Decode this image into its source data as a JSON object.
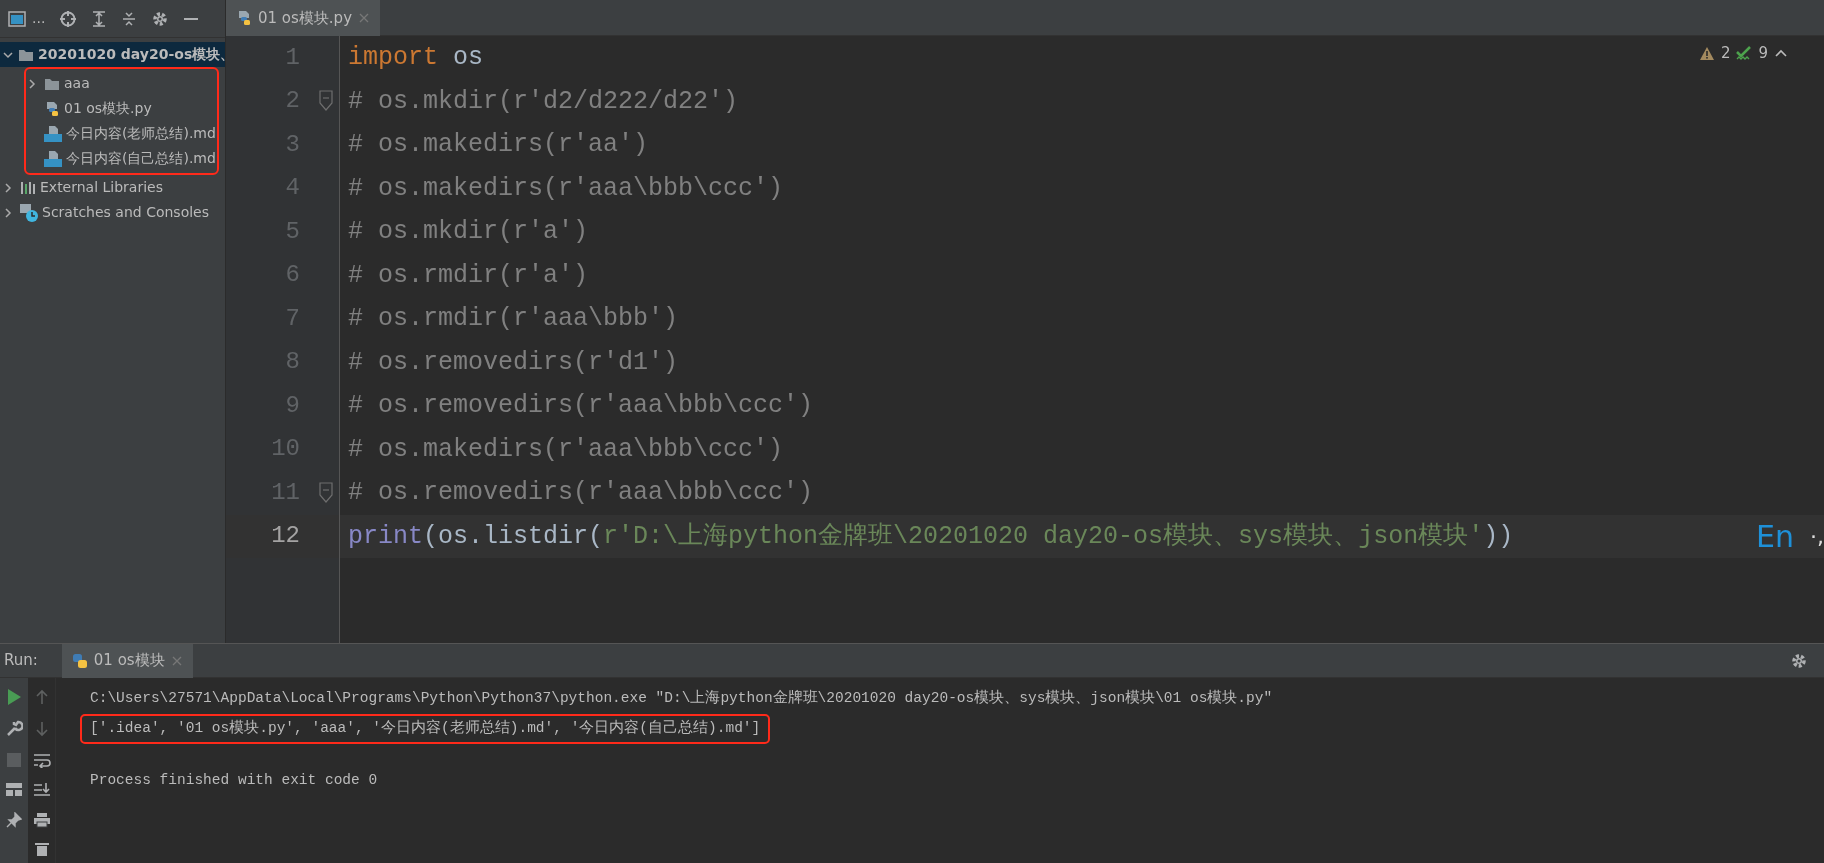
{
  "sidebar": {
    "title": "...",
    "tree": [
      {
        "kind": "project",
        "label": "20201020 day20-os模块、",
        "expanded": true,
        "selected": true,
        "annotated": true,
        "children": [
          {
            "kind": "folder",
            "label": "aaa",
            "expanded": false,
            "selected": false
          },
          {
            "kind": "python",
            "label": "01 os模块.py",
            "selected": false
          },
          {
            "kind": "markdown",
            "label": "今日内容(老师总结).md",
            "selected": false
          },
          {
            "kind": "markdown",
            "label": "今日内容(自己总结).md",
            "selected": false
          }
        ]
      },
      {
        "kind": "libraries",
        "label": "External Libraries",
        "expanded": false,
        "selected": false
      },
      {
        "kind": "scratches",
        "label": "Scratches and Consoles",
        "expanded": false,
        "selected": false
      }
    ]
  },
  "editor": {
    "tabs": [
      {
        "label": "01 os模块.py",
        "selected": true
      }
    ],
    "inspections": {
      "warnings": "2",
      "typos": "9"
    },
    "lines": [
      {
        "number": "1",
        "current": false,
        "fold": false,
        "tokens": [
          {
            "kind": "keyword",
            "text": "import"
          },
          {
            "kind": "plain",
            "text": " os"
          }
        ]
      },
      {
        "number": "2",
        "current": false,
        "fold": true,
        "tokens": [
          {
            "kind": "comment",
            "text": "# os.mkdir(r'd2/d222/d22')"
          }
        ]
      },
      {
        "number": "3",
        "current": false,
        "fold": false,
        "tokens": [
          {
            "kind": "comment",
            "text": "# os.makedirs(r'aa')"
          }
        ]
      },
      {
        "number": "4",
        "current": false,
        "fold": false,
        "tokens": [
          {
            "kind": "comment",
            "text": "# os.makedirs(r'aaa\\bbb\\ccc')"
          }
        ]
      },
      {
        "number": "5",
        "current": false,
        "fold": false,
        "tokens": [
          {
            "kind": "comment",
            "text": "# os.mkdir(r'a')"
          }
        ]
      },
      {
        "number": "6",
        "current": false,
        "fold": false,
        "tokens": [
          {
            "kind": "comment",
            "text": "# os.rmdir(r'a')"
          }
        ]
      },
      {
        "number": "7",
        "current": false,
        "fold": false,
        "tokens": [
          {
            "kind": "comment",
            "text": "# os.rmdir(r'aaa\\bbb')"
          }
        ]
      },
      {
        "number": "8",
        "current": false,
        "fold": false,
        "tokens": [
          {
            "kind": "comment",
            "text": "# os.removedirs(r'd1')"
          }
        ]
      },
      {
        "number": "9",
        "current": false,
        "fold": false,
        "tokens": [
          {
            "kind": "comment",
            "text": "# os.removedirs(r'aaa\\bbb\\ccc')"
          }
        ]
      },
      {
        "number": "10",
        "current": false,
        "fold": false,
        "tokens": [
          {
            "kind": "comment",
            "text": "# os.makedirs(r'aaa\\bbb\\ccc')"
          }
        ]
      },
      {
        "number": "11",
        "current": false,
        "fold": true,
        "tokens": [
          {
            "kind": "comment",
            "text": "# os.removedirs(r'aaa\\bbb\\ccc')"
          }
        ]
      },
      {
        "number": "12",
        "current": true,
        "fold": false,
        "tokens": [
          {
            "kind": "builtin",
            "text": "print"
          },
          {
            "kind": "plain",
            "text": "(os.listdir("
          },
          {
            "kind": "string",
            "text": "r'D:\\上海python金牌班\\20201020 day20-os模块、sys模块、json模块'"
          },
          {
            "kind": "plain",
            "text": "))"
          }
        ]
      }
    ],
    "ime": {
      "mode": "En",
      "punctuation": "·,"
    }
  },
  "run": {
    "label": "Run:",
    "tabs": [
      {
        "label": "01 os模块",
        "selected": true
      }
    ],
    "console": [
      {
        "kind": "command",
        "text": "C:\\Users\\27571\\AppData\\Local\\Programs\\Python\\Python37\\python.exe \"D:\\上海python金牌班\\20201020 day20-os模块、sys模块、json模块\\01 os模块.py\"",
        "annotated": false
      },
      {
        "kind": "output",
        "text": "['.idea', '01 os模块.py', 'aaa', '今日内容(老师总结).md', '今日内容(自己总结).md']",
        "annotated": true
      },
      {
        "kind": "status",
        "text": "Process finished with exit code 0",
        "annotated": false
      }
    ]
  }
}
